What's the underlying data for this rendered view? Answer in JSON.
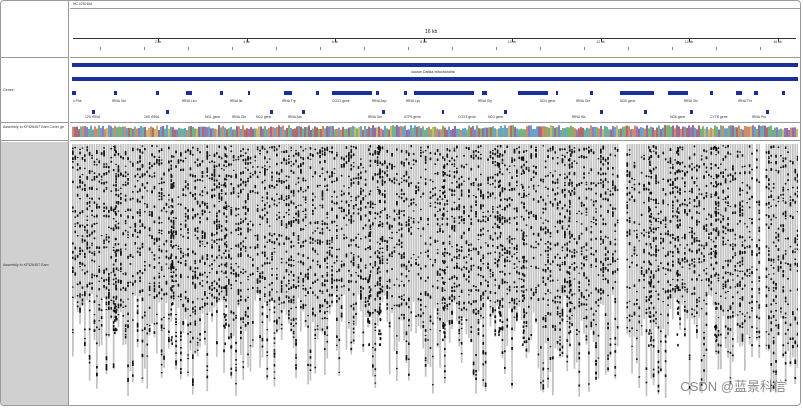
{
  "locus_text": "NC-0252464",
  "ruler": {
    "title": "16 kb",
    "ticks": [
      "2 kb",
      "4 kb",
      "6 kb",
      "8 kb",
      "10 kb",
      "12 kb",
      "14 kb",
      "16 kb"
    ]
  },
  "tracks": {
    "genes_label": "Genes",
    "coverage_label": "Assembly to KF326457 Eam Cover ge",
    "alignment_label": "Assembly to KF326457 Eam"
  },
  "gene_track": {
    "center_label": "source Dahlia mitochondria",
    "features_row1": [
      "s Phe",
      "tRNA Val",
      "tRNA Leu",
      "tRNA Ile",
      "tRNA Trp",
      "COX1 gene",
      "tRNA Asp",
      "tRNA Lys",
      "tRNA Gly",
      "ND4 gene",
      "tRNA Ser",
      "ND5 gene",
      "tRNA Glu",
      "tRNA Thr"
    ],
    "features_row2": [
      "12S rRNA",
      "16S rRNA",
      "ND1 gene",
      "tRNA Gln",
      "ND2 gene",
      "tRNA Ala",
      "tRNA Ser",
      "ATP6 gene",
      "COX3 gene",
      "ND3 gene",
      "tRNA His",
      "ND6 gene",
      "CYTB gene",
      "tRNA Pro"
    ]
  },
  "colors": {
    "gene_blue": "#1a2f9e",
    "read_grey": "#c2c2c2",
    "mismatch_black": "#111111",
    "panel_grey": "#d0d0d0"
  },
  "watermark": "CSDN @蓝景科信"
}
